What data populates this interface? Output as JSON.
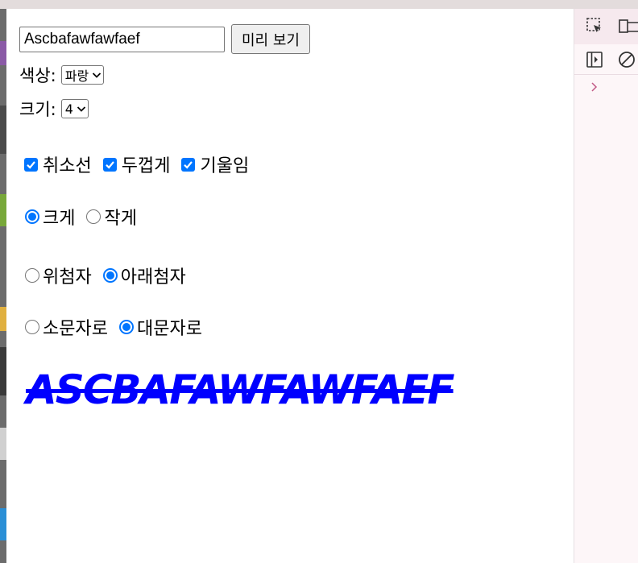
{
  "form": {
    "text_value": "Ascbafawfawfaef",
    "preview_button": "미리 보기",
    "color_label": "색상:",
    "color_selected": "파랑",
    "size_label": "크기:",
    "size_selected": "4"
  },
  "checkboxes": [
    {
      "label": "취소선",
      "checked": true
    },
    {
      "label": "두껍게",
      "checked": true
    },
    {
      "label": "기울임",
      "checked": true
    }
  ],
  "radio_size": [
    {
      "label": "크게",
      "selected": true
    },
    {
      "label": "작게",
      "selected": false
    }
  ],
  "radio_script": [
    {
      "label": "위첨자",
      "selected": false
    },
    {
      "label": "아래첨자",
      "selected": true
    }
  ],
  "radio_case": [
    {
      "label": "소문자로",
      "selected": false
    },
    {
      "label": "대문자로",
      "selected": true
    }
  ],
  "preview": {
    "text": "Ascbafawfawfaef",
    "color": "#0000ff"
  },
  "colors": {
    "accent": "#0075ff"
  },
  "devtools_icons": [
    "inspect-element-icon",
    "device-toolbar-icon",
    "sidebar-toggle-icon",
    "clear-console-icon",
    "expand-arrow-icon"
  ]
}
